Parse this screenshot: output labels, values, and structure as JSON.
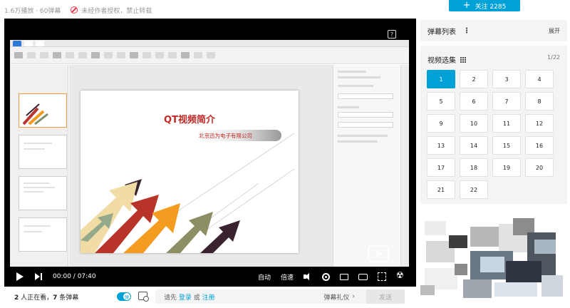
{
  "stats": {
    "views": "1.6万播放 · 60弹幕",
    "warning": "未经作者授权，禁止转载"
  },
  "follow": {
    "label": "关注 2285"
  },
  "video": {
    "slide_title": "QT视频简介",
    "slide_subtitle": "北京迅为电子有限公司",
    "time_display": "00:00 / 07:40"
  },
  "controls": {
    "auto_label": "自动",
    "speed_label": "倍速"
  },
  "under_bar": {
    "viewers_count": "2",
    "viewers_text": " 人正在看，",
    "danmaku_count": "7",
    "danmaku_text": " 条弹幕",
    "prompt_prefix": "请先",
    "login": "登录",
    "or": "或",
    "register": "注册",
    "etiquette": "弹幕礼仪",
    "send": "发送"
  },
  "danmaku_list": {
    "title": "弹幕列表",
    "expand": "展开"
  },
  "episodes": {
    "title": "视频选集",
    "count": "1/22",
    "items": [
      "1",
      "2",
      "3",
      "4",
      "5",
      "6",
      "7",
      "8",
      "9",
      "10",
      "11",
      "12",
      "13",
      "14",
      "15",
      "16",
      "17",
      "18",
      "19",
      "20",
      "21",
      "22"
    ],
    "active": "1"
  },
  "colors": {
    "accent": "#00a1d6",
    "slide_red": "#c02a26"
  }
}
